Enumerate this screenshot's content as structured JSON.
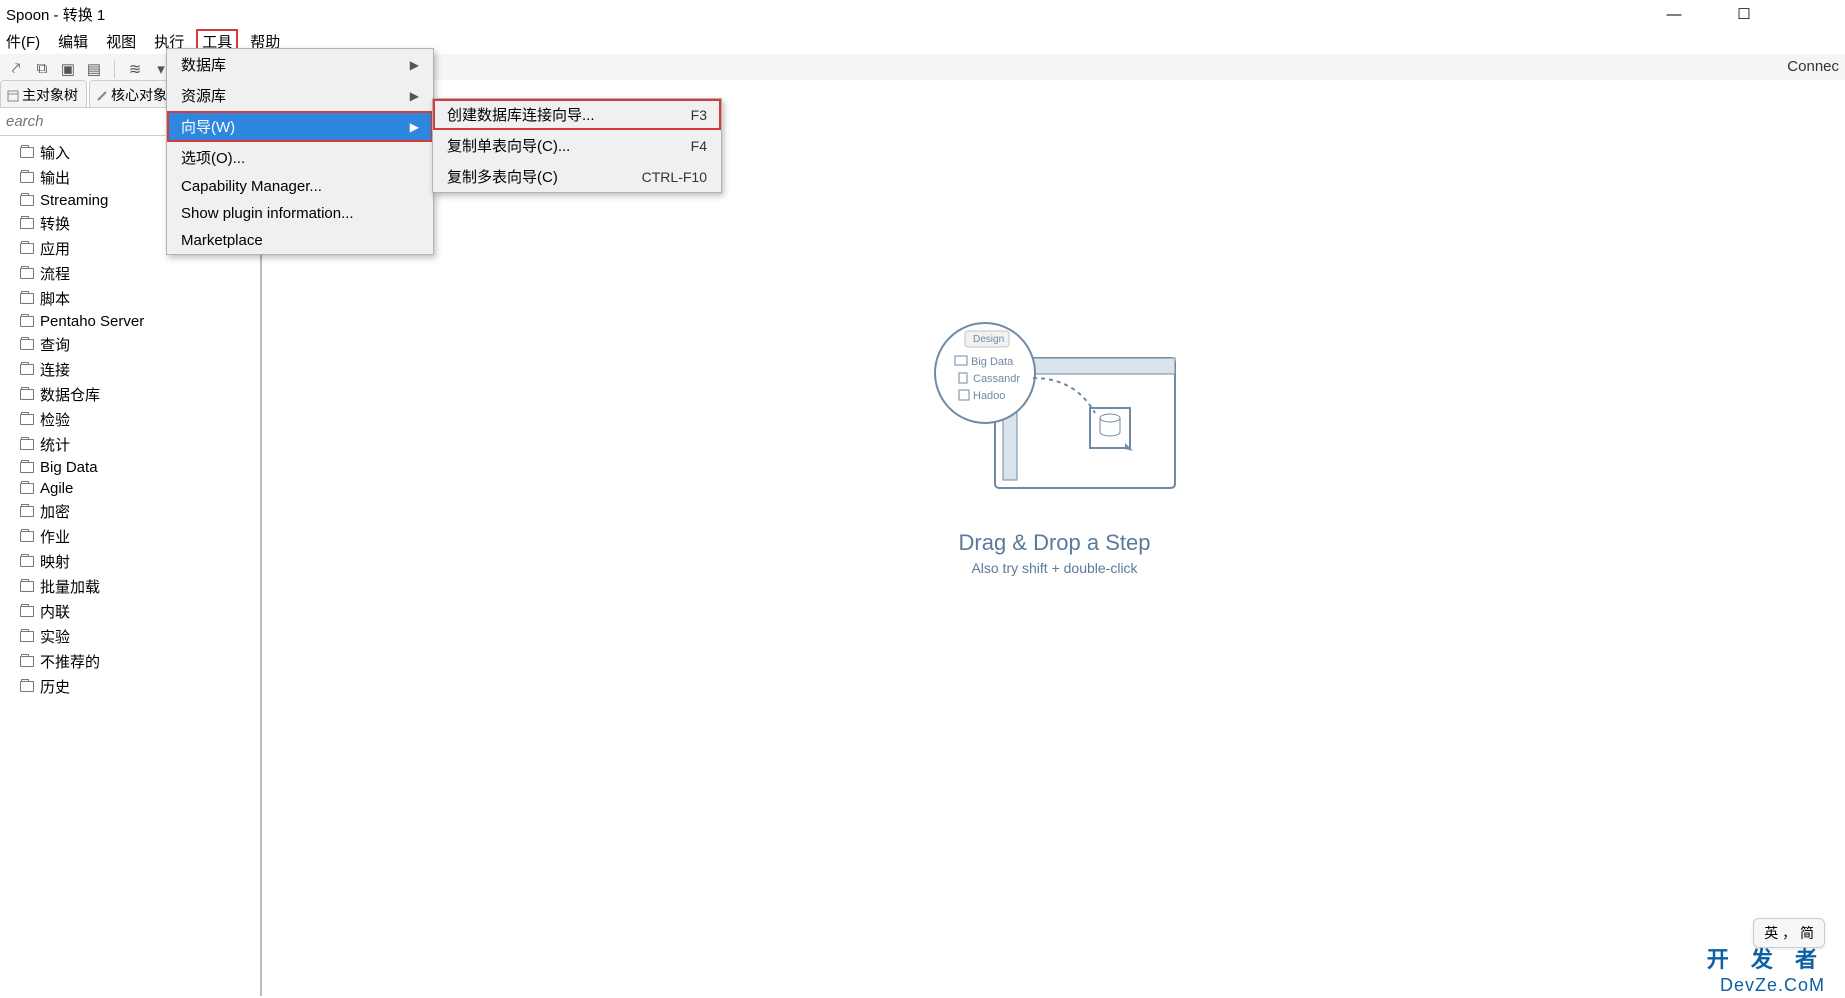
{
  "window": {
    "title": "Spoon - 转换 1"
  },
  "menubar": {
    "items": [
      "件(F)",
      "编辑",
      "视图",
      "执行",
      "工具",
      "帮助"
    ],
    "open_index": 4
  },
  "toolbar": {
    "connect_label": "Connec"
  },
  "left_panel": {
    "tabs": [
      "主对象树",
      "核心对象"
    ],
    "search_placeholder": "earch",
    "tree_items": [
      "输入",
      "输出",
      "Streaming",
      "转换",
      "应用",
      "流程",
      "脚本",
      "Pentaho Server",
      "查询",
      "连接",
      "数据仓库",
      "检验",
      "统计",
      "Big Data",
      "Agile",
      "加密",
      "作业",
      "映射",
      "批量加载",
      "内联",
      "实验",
      "不推荐的",
      "历史"
    ]
  },
  "dropdown_tools": {
    "items": [
      {
        "label": "数据库",
        "arrow": true
      },
      {
        "label": "资源库",
        "arrow": true
      },
      {
        "label": "向导(W)",
        "arrow": true,
        "highlight": true
      },
      {
        "label": "选项(O)...",
        "arrow": false
      },
      {
        "label": "Capability Manager...",
        "arrow": false
      },
      {
        "label": "Show plugin information...",
        "arrow": false
      },
      {
        "label": "Marketplace",
        "arrow": false
      }
    ]
  },
  "dropdown_wizard": {
    "items": [
      {
        "label": "创建数据库连接向导...",
        "shortcut": "F3",
        "hot": true
      },
      {
        "label": "复制单表向导(C)...",
        "shortcut": "F4",
        "hot": false
      },
      {
        "label": "复制多表向导(C)",
        "shortcut": "CTRL-F10",
        "hot": false
      }
    ]
  },
  "canvas_placeholder": {
    "diagram": {
      "tab_label": "Design",
      "item1": "Big Data",
      "item2": "Cassandr",
      "item3": "Hadoo"
    },
    "line1": "Drag & Drop a Step",
    "line2": "Also try shift + double-click"
  },
  "ime": {
    "text": "英 ， 简"
  },
  "watermark": {
    "text1": "开 发 者",
    "text2": "DevZe.CoM"
  }
}
